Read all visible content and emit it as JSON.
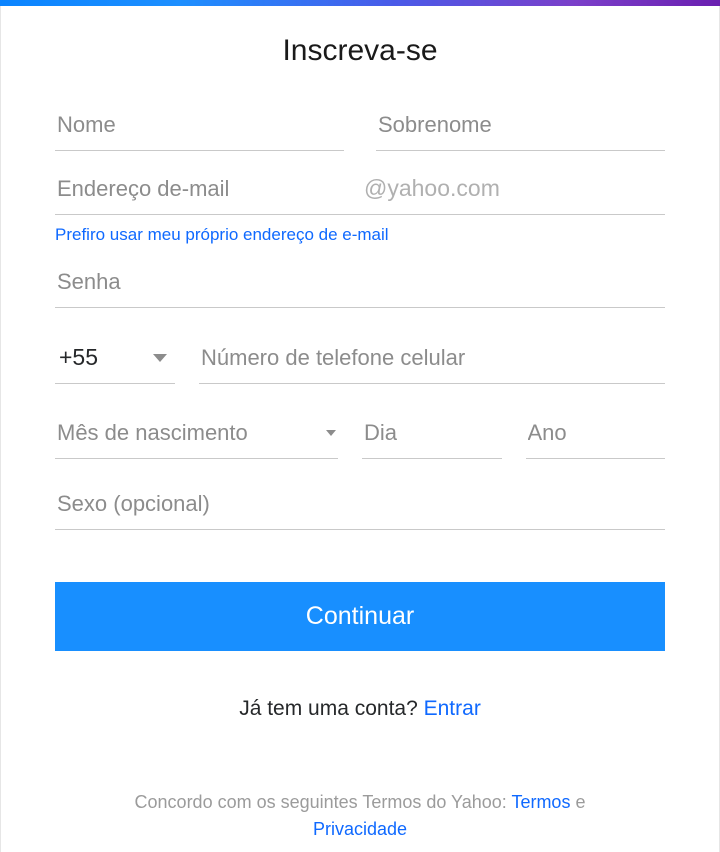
{
  "title": "Inscreva-se",
  "firstName": {
    "placeholder": "Nome"
  },
  "lastName": {
    "placeholder": "Sobrenome"
  },
  "email": {
    "placeholder": "Endereço de-mail",
    "domain": "@yahoo.com"
  },
  "ownEmailLink": "Prefiro usar meu próprio endereço de e-mail",
  "password": {
    "placeholder": "Senha"
  },
  "phone": {
    "countryCode": "+55",
    "placeholder": "Número de telefone celular"
  },
  "birth": {
    "monthLabel": "Mês de nascimento",
    "dayPlaceholder": "Dia",
    "yearPlaceholder": "Ano"
  },
  "gender": {
    "placeholder": "Sexo (opcional)"
  },
  "continueLabel": "Continuar",
  "already": {
    "question": "Já tem uma conta? ",
    "login": "Entrar"
  },
  "agree": {
    "prefix": "Concordo com os seguintes Termos do Yahoo: ",
    "terms": "Termos",
    "and": " e ",
    "privacy": "Privacidade"
  }
}
